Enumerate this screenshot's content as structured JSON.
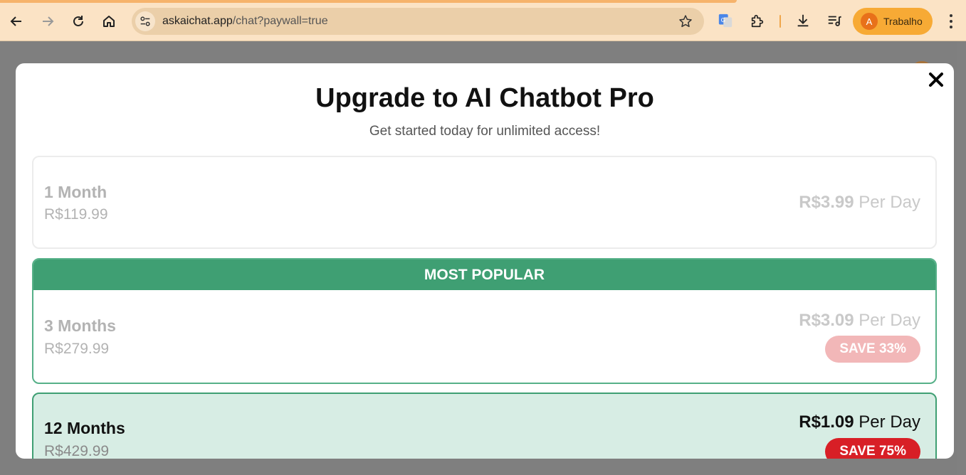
{
  "browser": {
    "url_host": "askaichat.app",
    "url_path": "/chat?paywall=true",
    "profile_initial": "A",
    "profile_name": "Trabalho"
  },
  "modal": {
    "title": "Upgrade to AI Chatbot Pro",
    "subtitle": "Get started today for unlimited access!",
    "plans": [
      {
        "name": "1 Month",
        "total": "R$119.99",
        "per_day_price": "R$3.99",
        "per_day_suffix": "Per Day"
      },
      {
        "badge": "MOST POPULAR",
        "name": "3 Months",
        "total": "R$279.99",
        "per_day_price": "R$3.09",
        "per_day_suffix": "Per Day",
        "save": "SAVE 33%"
      },
      {
        "name": "12 Months",
        "total": "R$429.99",
        "per_day_price": "R$1.09",
        "per_day_suffix": "Per Day",
        "save": "SAVE 75%",
        "selected": true
      }
    ]
  },
  "colors": {
    "popular_green": "#3f9f73",
    "selected_bg": "#d7ede4",
    "save_red": "#d81f26",
    "save_red_faded": "#f2b7b8"
  }
}
